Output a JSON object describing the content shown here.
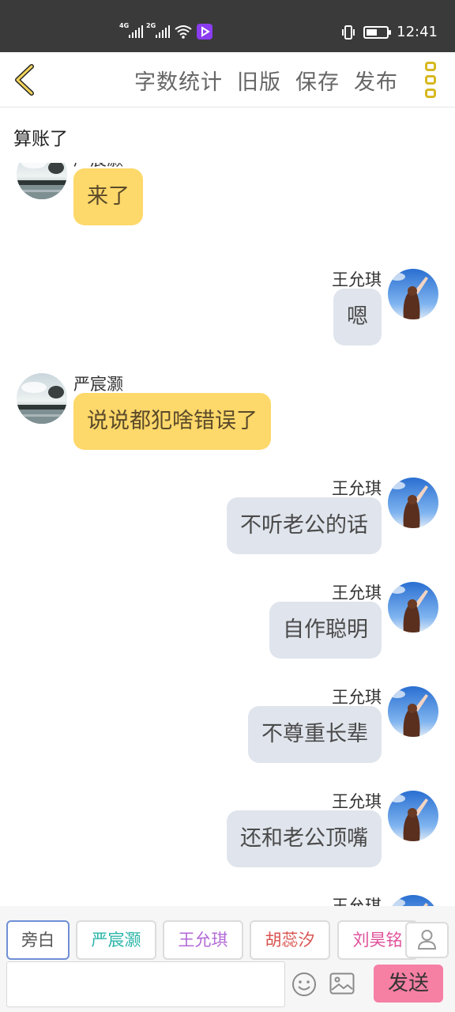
{
  "status_bar": {
    "net1": "4G",
    "net2": "2G",
    "time": "12:41",
    "battery_percent": 55
  },
  "top_bar": {
    "back_icon": "chevron-left-icon",
    "actions": [
      "字数统计",
      "旧版",
      "保存",
      "发布"
    ],
    "more_icon": "more-vertical-icon",
    "accent_color": "#d7b81f"
  },
  "story_title": "算账了",
  "messages": [
    {
      "sender": "严宸灏",
      "side": "left",
      "text": "来了"
    },
    {
      "sender": "王允琪",
      "side": "right",
      "text": "嗯"
    },
    {
      "sender": "严宸灏",
      "side": "left",
      "text": "说说都犯啥错误了"
    },
    {
      "sender": "王允琪",
      "side": "right",
      "text": "不听老公的话"
    },
    {
      "sender": "王允琪",
      "side": "right",
      "text": "自作聪明"
    },
    {
      "sender": "王允琪",
      "side": "right",
      "text": "不尊重长辈"
    },
    {
      "sender": "王允琪",
      "side": "right",
      "text": "还和老公顶嘴"
    },
    {
      "sender": "王允琪",
      "side": "right",
      "text": ""
    }
  ],
  "roles": [
    {
      "label": "旁白",
      "color": "#555555",
      "active": true
    },
    {
      "label": "严宸灏",
      "color": "#2bb5a8",
      "active": false
    },
    {
      "label": "王允琪",
      "color": "#b26ad6",
      "active": false
    },
    {
      "label": "胡蕊汐",
      "color": "#d9534f",
      "active": false
    },
    {
      "label": "刘昊铭",
      "color": "#e0509a",
      "active": false
    }
  ],
  "composer": {
    "placeholder": "",
    "send_label": "发送",
    "emoji_icon": "emoji-icon",
    "image_icon": "image-icon",
    "person_icon": "person-icon"
  }
}
